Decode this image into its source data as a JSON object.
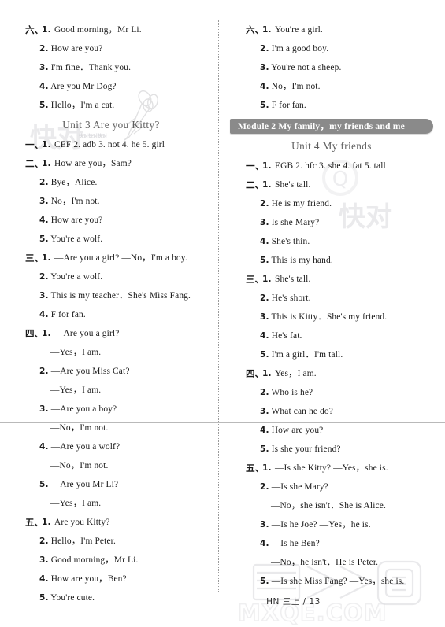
{
  "footer": {
    "text": "HN 三上 / 13"
  },
  "watermarks": {
    "brand_cn": "快对",
    "tiny_repeat": "快对快对快对",
    "site": "MXQE.COM",
    "stamp_cn": "答案卷"
  },
  "left_column": {
    "blocks": [
      {
        "type": "answers",
        "lines": [
          {
            "marker": "六、",
            "num": "1.",
            "text": "Good morning，Mr Li."
          },
          {
            "num": "2.",
            "text": "How are you?"
          },
          {
            "num": "3.",
            "text": "I'm fine．Thank you."
          },
          {
            "num": "4.",
            "text": "Are you Mr Dog?"
          },
          {
            "num": "5.",
            "text": "Hello，I'm a cat."
          }
        ]
      },
      {
        "type": "unit_title",
        "text": "Unit 3   Are you Kitty?"
      },
      {
        "type": "answers",
        "lines": [
          {
            "marker": "一、",
            "num": "1.",
            "text": "CEF   2. adb   3. not   4. he   5. girl"
          },
          {
            "marker": "二、",
            "num": "1.",
            "text": "How are you，Sam?"
          },
          {
            "num": "2.",
            "text": "Bye，Alice."
          },
          {
            "num": "3.",
            "text": "No，I'm not."
          },
          {
            "num": "4.",
            "text": "How are you?"
          },
          {
            "num": "5.",
            "text": "You're a wolf."
          },
          {
            "marker": "三、",
            "num": "1.",
            "text": "—Are you a girl? —No，I'm a boy."
          },
          {
            "num": "2.",
            "text": "You're a wolf."
          },
          {
            "num": "3.",
            "text": "This is my teacher．She's Miss Fang."
          },
          {
            "num": "4.",
            "text": "F for fan."
          },
          {
            "marker": "四、",
            "num": "1.",
            "text": "—Are you a girl?"
          },
          {
            "sub": "—Yes，I am."
          },
          {
            "num": "2.",
            "text": "—Are you Miss Cat?"
          },
          {
            "sub": "—Yes，I am."
          },
          {
            "num": "3.",
            "text": "—Are you a boy?"
          },
          {
            "sub": "—No，I'm not."
          },
          {
            "num": "4.",
            "text": "—Are you a wolf?"
          },
          {
            "sub": "—No，I'm not."
          },
          {
            "num": "5.",
            "text": "—Are you Mr Li?"
          },
          {
            "sub": "—Yes，I am."
          },
          {
            "marker": "五、",
            "num": "1.",
            "text": "Are you Kitty?"
          },
          {
            "num": "2.",
            "text": "Hello，I'm Peter."
          },
          {
            "num": "3.",
            "text": "Good morning，Mr Li."
          },
          {
            "num": "4.",
            "text": "How are you，Ben?"
          },
          {
            "num": "5.",
            "text": "You're cute."
          }
        ]
      }
    ]
  },
  "right_column": {
    "blocks": [
      {
        "type": "answers",
        "lines": [
          {
            "marker": "六、",
            "num": "1.",
            "text": "You're a girl."
          },
          {
            "num": "2.",
            "text": "I'm a good boy."
          },
          {
            "num": "3.",
            "text": "You're not a sheep."
          },
          {
            "num": "4.",
            "text": "No，I'm not."
          },
          {
            "num": "5.",
            "text": "F for fan."
          }
        ]
      },
      {
        "type": "module_banner",
        "text": "Module 2   My family，my friends and me"
      },
      {
        "type": "unit_title",
        "text": "Unit 4   My friends"
      },
      {
        "type": "answers",
        "lines": [
          {
            "marker": "一、",
            "num": "1.",
            "text": "EGB   2. hfc   3. she   4. fat   5. tall"
          },
          {
            "marker": "二、",
            "num": "1.",
            "text": "She's tall."
          },
          {
            "num": "2.",
            "text": "He is my friend."
          },
          {
            "num": "3.",
            "text": "Is she Mary?"
          },
          {
            "num": "4.",
            "text": "She's thin."
          },
          {
            "num": "5.",
            "text": "This is my hand."
          },
          {
            "marker": "三、",
            "num": "1.",
            "text": "She's tall."
          },
          {
            "num": "2.",
            "text": "He's short."
          },
          {
            "num": "3.",
            "text": "This is Kitty．She's my friend."
          },
          {
            "num": "4.",
            "text": "He's fat."
          },
          {
            "num": "5.",
            "text": "I'm a girl．I'm tall."
          },
          {
            "marker": "四、",
            "num": "1.",
            "text": "Yes，I am."
          },
          {
            "num": "2.",
            "text": "Who is he?"
          },
          {
            "num": "3.",
            "text": "What can he do?"
          },
          {
            "num": "4.",
            "text": "How are you?"
          },
          {
            "num": "5.",
            "text": "Is she your friend?"
          },
          {
            "marker": "五、",
            "num": "1.",
            "text": "—Is she Kitty? —Yes，she is."
          },
          {
            "num": "2.",
            "text": "—Is she Mary?"
          },
          {
            "sub": "—No，she isn't．She is Alice."
          },
          {
            "num": "3.",
            "text": "—Is he Joe? —Yes，he is."
          },
          {
            "num": "4.",
            "text": "—Is he Ben?"
          },
          {
            "sub": "—No，he isn't．He is Peter."
          },
          {
            "num": "5.",
            "text": "—Is she Miss Fang? —Yes，she is."
          }
        ]
      }
    ]
  }
}
